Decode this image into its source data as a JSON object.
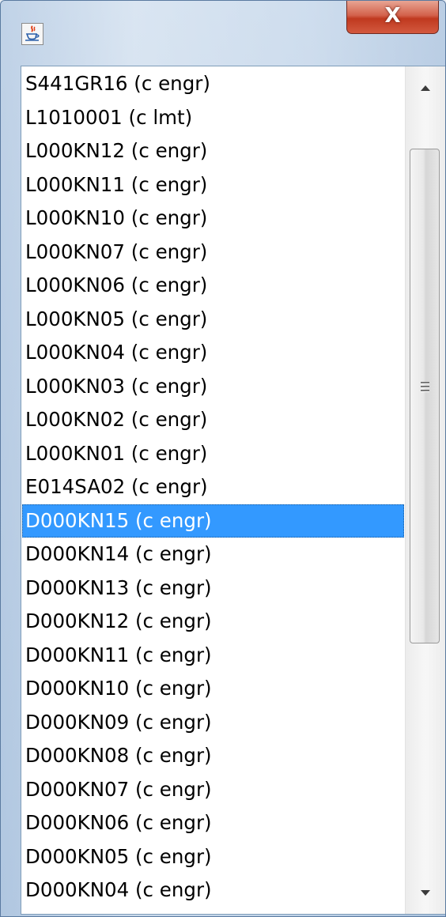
{
  "window": {
    "app_icon": "java-cup-icon",
    "close_icon": "close-x-icon",
    "close_glyph": "X"
  },
  "list": {
    "selected_index": 13,
    "items": [
      "S441GR16 (c engr)",
      "L1010001 (c lmt)",
      "L000KN12 (c engr)",
      "L000KN11 (c engr)",
      "L000KN10 (c engr)",
      "L000KN07 (c engr)",
      "L000KN06 (c engr)",
      "L000KN05 (c engr)",
      "L000KN04 (c engr)",
      "L000KN03 (c engr)",
      "L000KN02 (c engr)",
      "L000KN01 (c engr)",
      "E014SA02 (c engr)",
      "D000KN15 (c engr)",
      "D000KN14 (c engr)",
      "D000KN13 (c engr)",
      "D000KN12 (c engr)",
      "D000KN11 (c engr)",
      "D000KN10 (c engr)",
      "D000KN09 (c engr)",
      "D000KN08 (c engr)",
      "D000KN07 (c engr)",
      "D000KN06 (c engr)",
      "D000KN05 (c engr)",
      "D000KN04 (c engr)"
    ]
  },
  "scrollbar": {
    "up_icon": "arrow-up-icon",
    "down_icon": "arrow-down-icon",
    "grip_icon": "grip-lines-icon"
  },
  "colors": {
    "selection": "#3399ff",
    "close_button": "#c7432a"
  }
}
